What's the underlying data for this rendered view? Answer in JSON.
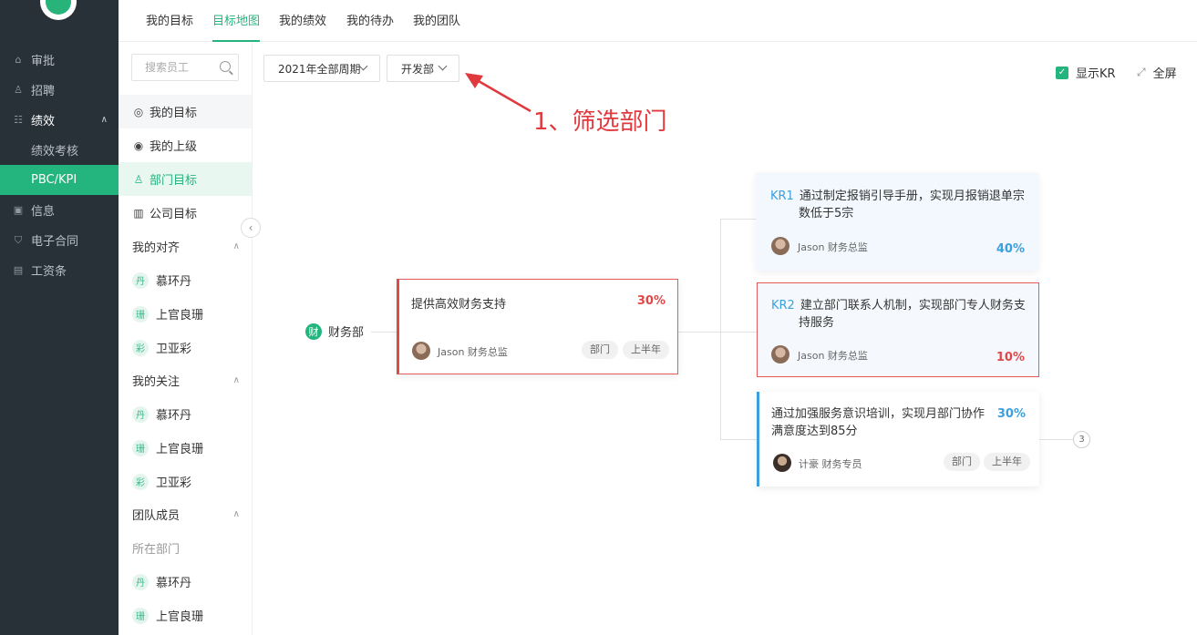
{
  "nav": {
    "items": [
      {
        "icon": "home-icon",
        "glyph": "⌂",
        "label": "审批"
      },
      {
        "icon": "recruit-icon",
        "glyph": "♙",
        "label": "招聘"
      },
      {
        "icon": "performance-icon",
        "glyph": "☷",
        "label": "绩效"
      },
      {
        "label": "绩效考核"
      },
      {
        "label": "PBC/KPI"
      },
      {
        "icon": "info-icon",
        "glyph": "▣",
        "label": "信息"
      },
      {
        "icon": "contract-icon",
        "glyph": "⛉",
        "label": "电子合同"
      },
      {
        "icon": "payslip-icon",
        "glyph": "▤",
        "label": "工资条"
      }
    ]
  },
  "tabs": [
    "我的目标",
    "目标地图",
    "我的绩效",
    "我的待办",
    "我的团队"
  ],
  "side": {
    "search_placeholder": "搜索员工",
    "items": [
      {
        "glyph": "◎",
        "label": "我的目标"
      },
      {
        "glyph": "◉",
        "label": "我的上级"
      },
      {
        "glyph": "♙",
        "label": "部门目标"
      },
      {
        "glyph": "▥",
        "label": "公司目标"
      }
    ],
    "align_head": "我的对齐",
    "align": [
      {
        "badge": "丹",
        "name": "慕环丹"
      },
      {
        "badge": "珊",
        "name": "上官良珊"
      },
      {
        "badge": "彩",
        "name": "卫亚彩"
      }
    ],
    "follow_head": "我的关注",
    "follow": [
      {
        "badge": "丹",
        "name": "慕环丹"
      },
      {
        "badge": "珊",
        "name": "上官良珊"
      },
      {
        "badge": "彩",
        "name": "卫亚彩"
      }
    ],
    "team_head": "团队成员",
    "team_sub": "所在部门",
    "team": [
      {
        "badge": "丹",
        "name": "慕环丹"
      },
      {
        "badge": "珊",
        "name": "上官良珊"
      }
    ]
  },
  "filters": {
    "period": "2021年全部周期",
    "department": "开发部"
  },
  "show_kr_label": "显示KR",
  "fullscreen_label": "全屏",
  "annotation": "1、筛选部门",
  "map": {
    "root": {
      "badge": "财",
      "label": "财务部"
    },
    "objective": {
      "title": "提供高效财务支持",
      "progress": "30%",
      "owner": "Jason 财务总监",
      "tag1": "部门",
      "tag2": "上半年"
    },
    "krs": [
      {
        "label": "KR1",
        "line1": "通过制定报销引导手册，实现月报销退单宗",
        "line2": "数低于5宗",
        "owner": "Jason  财务总监",
        "progress": "40%"
      },
      {
        "label": "KR2",
        "line1": "建立部门联系人机制，实现部门专人财务支",
        "line2": "持服务",
        "owner": "Jason  财务总监",
        "progress": "10%"
      },
      {
        "line1": "通过加强服务意识培训，实现月部门协作",
        "line2": "满意度达到85分",
        "owner": "计豪  财务专员",
        "progress": "30%",
        "tag1": "部门",
        "tag2": "上半年"
      }
    ],
    "child_count": "3"
  },
  "colors": {
    "accent": "#24b47e",
    "nav_bg": "#283038",
    "danger": "#e04848",
    "info": "#3aa0de"
  }
}
